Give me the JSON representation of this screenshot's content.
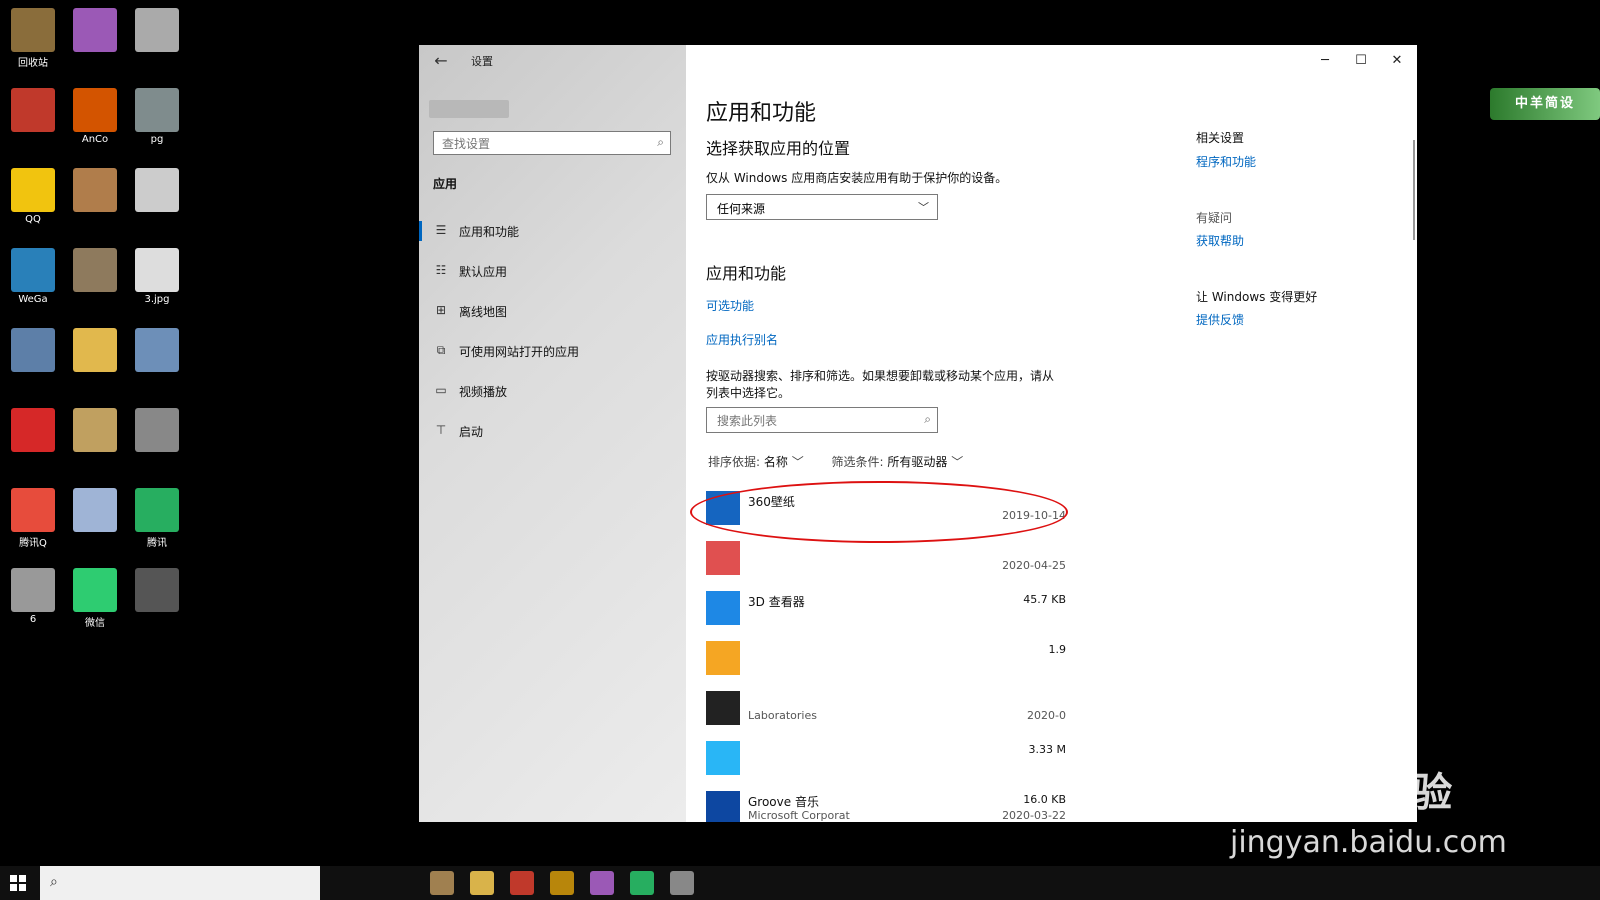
{
  "desktop": {
    "icons": [
      {
        "label": "回收站",
        "color": "#8a6d3b"
      },
      {
        "label": "",
        "color": "#9b59b6"
      },
      {
        "label": "",
        "color": "#aaaaaa"
      },
      {
        "label": "",
        "color": "#c0392b"
      },
      {
        "label": "AnCo",
        "color": "#d35400"
      },
      {
        "label": "pg",
        "color": "#7f8c8d"
      },
      {
        "label": "QQ",
        "color": "#f1c40f"
      },
      {
        "label": "",
        "color": "#b07d4b"
      },
      {
        "label": "",
        "color": "#cccccc"
      },
      {
        "label": "WeGa",
        "color": "#2980b9"
      },
      {
        "label": "",
        "color": "#8e7a5d"
      },
      {
        "label": "3.jpg",
        "color": "#dddddd"
      },
      {
        "label": "",
        "color": "#5d7fa8"
      },
      {
        "label": "",
        "color": "#e1b84d"
      },
      {
        "label": "",
        "color": "#6d8fb8"
      },
      {
        "label": "",
        "color": "#d62828"
      },
      {
        "label": "",
        "color": "#c0a060"
      },
      {
        "label": "",
        "color": "#888888"
      },
      {
        "label": "腾讯Q",
        "color": "#e74c3c"
      },
      {
        "label": "",
        "color": "#9fb4d6"
      },
      {
        "label": "腾讯",
        "color": "#27ae60"
      },
      {
        "label": "6",
        "color": "#999999"
      },
      {
        "label": "微信",
        "color": "#2ecc71"
      },
      {
        "label": "",
        "color": "#555555"
      }
    ]
  },
  "window": {
    "title": "设置",
    "sidebar": {
      "search_placeholder": "查找设置",
      "heading": "应用",
      "items": [
        {
          "icon": "list-icon",
          "glyph": "☰",
          "label": "应用和功能",
          "active": true
        },
        {
          "icon": "default-apps-icon",
          "glyph": "☷",
          "label": "默认应用",
          "active": false
        },
        {
          "icon": "map-icon",
          "glyph": "⊞",
          "label": "离线地图",
          "active": false
        },
        {
          "icon": "open-web-icon",
          "glyph": "⧉",
          "label": "可使用网站打开的应用",
          "active": false
        },
        {
          "icon": "video-icon",
          "glyph": "▭",
          "label": "视频播放",
          "active": false
        },
        {
          "icon": "startup-icon",
          "glyph": "⊤",
          "label": "启动",
          "active": false
        }
      ]
    },
    "controls": {
      "minimize": "─",
      "maximize": "☐",
      "close": "✕"
    },
    "main": {
      "page_title": "应用和功能",
      "install_section": {
        "title": "选择获取应用的位置",
        "description": "仅从 Windows 应用商店安装应用有助于保护你的设备。",
        "dropdown_value": "任何来源"
      },
      "apps_section": {
        "title": "应用和功能",
        "link_optional": "可选功能",
        "link_alias": "应用执行别名",
        "description_1": "按驱动器搜索、排序和筛选。如果想要卸载或移动某个应用，请从",
        "description_2": "列表中选择它。",
        "search_placeholder": "搜索此列表",
        "sort_label": "排序依据:",
        "sort_value": "名称",
        "filter_label": "筛选条件:",
        "filter_value": "所有驱动器"
      },
      "apps": [
        {
          "name": "360壁纸",
          "publisher": "",
          "size": "",
          "date": "2019-10-14",
          "icon_color": "#1565c0"
        },
        {
          "name": "",
          "publisher": "",
          "size": "",
          "date": "2020-04-25",
          "icon_color": "#e05050"
        },
        {
          "name": "3D 查看器",
          "publisher": "",
          "size": "45.7 KB",
          "date": "",
          "icon_color": "#1e88e5"
        },
        {
          "name": "",
          "publisher": "",
          "size": "1.9",
          "date": "",
          "icon_color": "#f5a623"
        },
        {
          "name": "",
          "publisher": "Laboratories",
          "size": "",
          "date": "2020-0",
          "icon_color": "#222222"
        },
        {
          "name": "",
          "publisher": "",
          "size": "3.33 M",
          "date": "",
          "icon_color": "#29b6f6"
        },
        {
          "name": "Groove 音乐",
          "publisher": "Microsoft Corporat",
          "size": "16.0 KB",
          "date": "2020-03-22",
          "icon_color": "#0d47a1"
        }
      ],
      "related": {
        "heading": "相关设置",
        "link1": "程序和功能",
        "help_heading": "有疑问",
        "help_link": "获取帮助",
        "feedback_heading": "让 Windows 变得更好",
        "feedback_link": "提供反馈"
      }
    }
  },
  "watermark": {
    "badge": "中羊简设",
    "main": "Baidu 经验",
    "sub": "jingyan.baidu.com"
  },
  "taskbar": {
    "search_placeholder": "",
    "apps": [
      {
        "name": "file-icon",
        "color": "#a08050"
      },
      {
        "name": "folder-icon",
        "color": "#d9b34a"
      },
      {
        "name": "red-app-icon",
        "color": "#c0392b"
      },
      {
        "name": "bag-icon",
        "color": "#b8860b"
      },
      {
        "name": "colorful-app-icon",
        "color": "#9b59b6"
      },
      {
        "name": "wechat-icon",
        "color": "#27ae60"
      },
      {
        "name": "settings-icon",
        "color": "#888888"
      }
    ]
  }
}
